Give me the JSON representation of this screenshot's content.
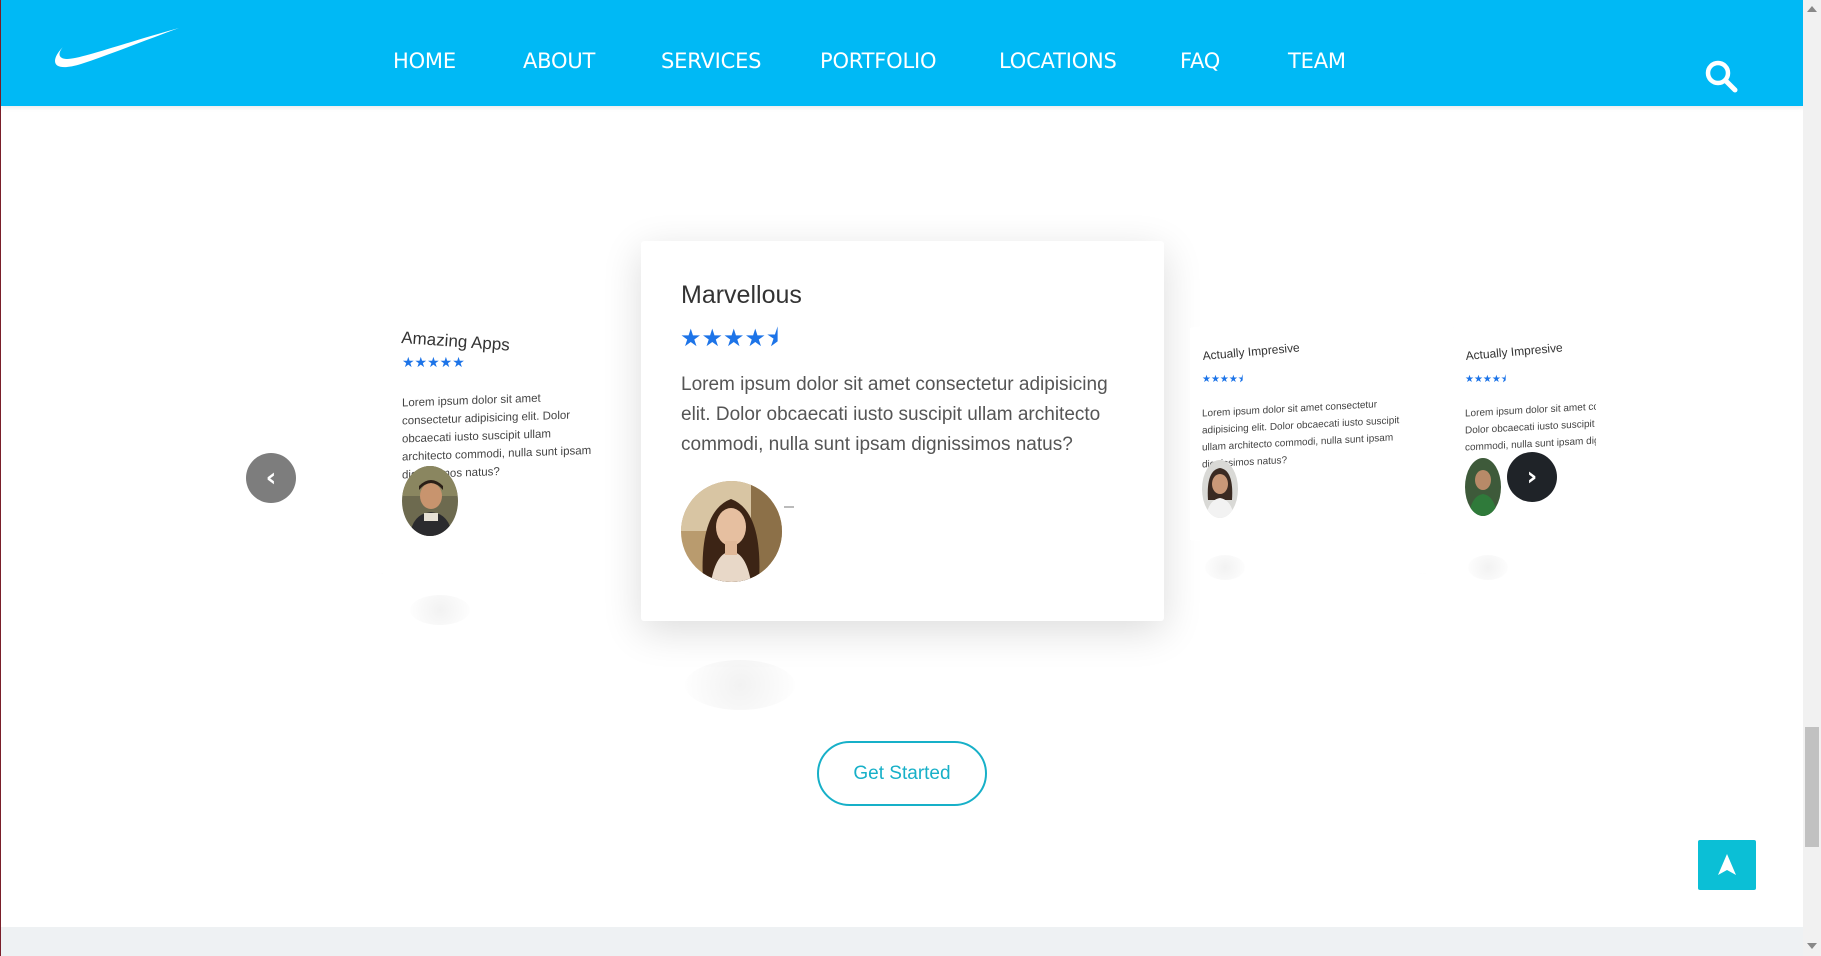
{
  "header": {
    "logo": "swoosh-logo",
    "nav": [
      "HOME",
      "ABOUT",
      "SERVICES",
      "PORTFOLIO",
      "LOCATIONS",
      "FAQ",
      "TEAM"
    ],
    "search_icon": "search-icon",
    "brand_color": "#00b9f5"
  },
  "testimonials": [
    {
      "title": "Amazing Apps",
      "stars": "★★★★★",
      "text": "Lorem ipsum dolor sit amet consectetur adipisicing elit. Dolor obcaecati iusto suscipit ullam architecto commodi, nulla sunt ipsam dignissimos natus?"
    },
    {
      "title": "Marvellous",
      "stars": "★★★★⯨",
      "rating": 4.5,
      "text": "Lorem ipsum dolor sit amet consectetur adipisicing elit. Dolor obcaecati iusto suscipit ullam architecto commodi, nulla sunt ipsam dignissimos natus?"
    },
    {
      "title": "Actually Impresive",
      "stars": "★★★★⯨",
      "text": "Lorem ipsum dolor sit amet consectetur adipisicing elit. Dolor obcaecati iusto suscipit ullam architecto commodi, nulla sunt ipsam dignissimos natus?"
    },
    {
      "title": "Actually Impresive",
      "stars": "★★★★⯨",
      "text_lines": [
        "Lorem ipsum dolor sit amet consectetur",
        "Dolor obcaecati iusto suscipit ullam arch",
        "commodi, nulla sunt ipsam dignissimos i"
      ]
    }
  ],
  "carousel": {
    "prev_icon": "chevron-left-icon",
    "next_icon": "chevron-right-icon",
    "prev_glyph": "‹",
    "next_glyph": "›"
  },
  "cta": {
    "label": "Get Started",
    "color": "#17b0c8"
  },
  "back_to_top": {
    "icon": "arrow-up-icon",
    "color": "#0bbfd6"
  }
}
